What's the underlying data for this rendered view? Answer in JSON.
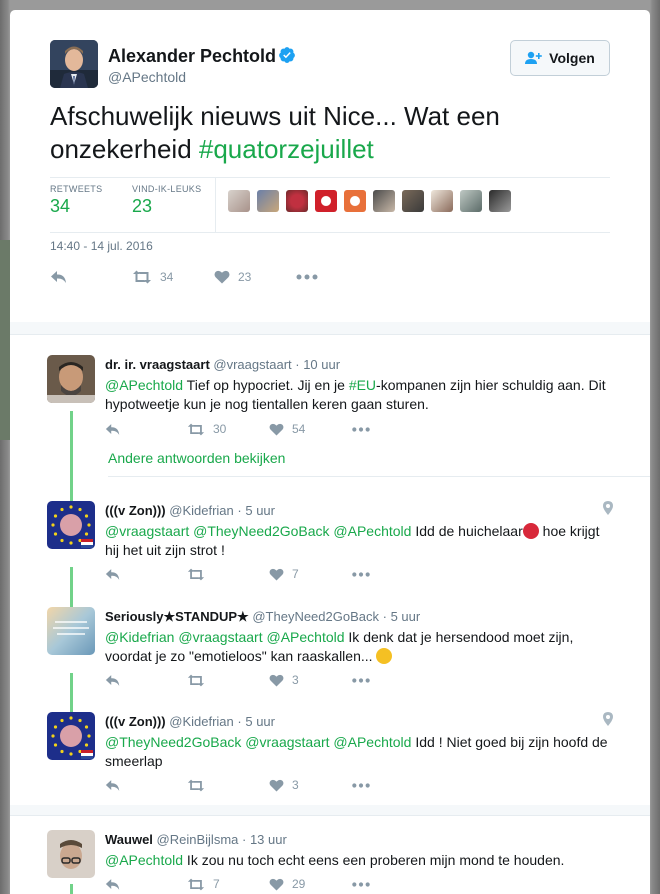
{
  "main_tweet": {
    "author_name": "Alexander Pechtold",
    "author_handle": "@APechtold",
    "follow_label": "Volgen",
    "text_before": "Afschuwelijk nieuws uit Nice... Wat een onzekerheid ",
    "hashtag": "#quatorzejuillet",
    "retweets_label": "RETWEETS",
    "retweets_count": "34",
    "likes_label": "VIND-IK-LEUKS",
    "likes_count": "23",
    "timestamp": "14:40 - 14 jul. 2016",
    "action_retweet_count": "34",
    "action_like_count": "23"
  },
  "replies": [
    {
      "name": "dr. ir. vraagstaart",
      "handle": "@vraagstaart",
      "time": "· 10 uur",
      "mention1": "@APechtold",
      "text1": " Tief op hypocriet. Jij en je ",
      "hashtag": "#EU",
      "text2": "-kompanen zijn hier schuldig aan. Dit hypotweetje kun je nog tientallen keren gaan sturen.",
      "retweets": "30",
      "likes": "54"
    },
    {
      "name": "(((v Zon)))",
      "handle": "@Kidefrian",
      "time": "· 5 uur",
      "mentions": "@vraagstaart @TheyNeed2GoBack @APechtold",
      "text1": " Idd de huichelaar",
      "text2": " hoe krijgt hij het uit zijn strot !",
      "retweets": "",
      "likes": "7"
    },
    {
      "name": "Seriously★STANDUP★",
      "handle": "@TheyNeed2GoBack",
      "time": "· 5 uur",
      "mentions": "@Kidefrian @vraagstaart @APechtold",
      "text1": " Ik denk dat je hersendood moet zijn, voordat je zo \"emotieloos\" kan raaskallen... ",
      "retweets": "",
      "likes": "3"
    },
    {
      "name": "(((v Zon)))",
      "handle": "@Kidefrian",
      "time": "· 5 uur",
      "mentions": "@TheyNeed2GoBack @vraagstaart @APechtold",
      "text1": " Idd ! Niet goed bij zijn hoofd de smeerlap",
      "retweets": "",
      "likes": "3"
    },
    {
      "name": "Wauwel",
      "handle": "@ReinBijlsma",
      "time": "· 13 uur",
      "mention1": "@APechtold",
      "text1": " Ik zou nu toch echt eens een proberen mijn mond te houden.",
      "retweets": "7",
      "likes": "29"
    }
  ],
  "more_replies_label": "Andere antwoorden bekijken",
  "colors": {
    "accent_green": "#19a84b",
    "thread_line": "#71d289",
    "verified_blue": "#1da1f2",
    "icon_gray": "#8899a6"
  }
}
